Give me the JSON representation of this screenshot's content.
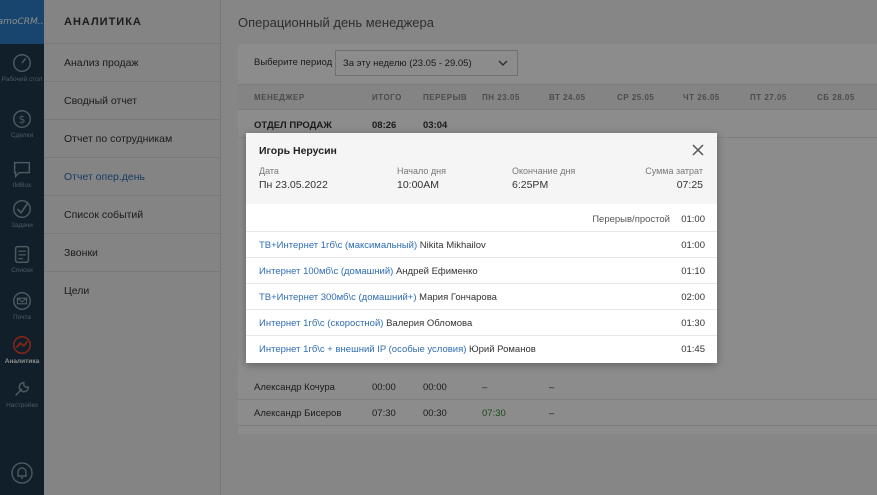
{
  "app": {
    "logo_text": "amoCRM..."
  },
  "rail": {
    "items": [
      {
        "label": "Рабочий стол",
        "icon": "dashboard-icon"
      },
      {
        "label": "Сделки",
        "icon": "dollar-icon"
      },
      {
        "label": "IMBox",
        "icon": "chat-icon"
      },
      {
        "label": "Задачи",
        "icon": "check-icon"
      },
      {
        "label": "Списки",
        "icon": "list-icon"
      },
      {
        "label": "Почта",
        "icon": "mail-icon"
      },
      {
        "label": "Аналитика",
        "icon": "analytics-icon",
        "active": true
      },
      {
        "label": "Настройки",
        "icon": "settings-icon"
      }
    ]
  },
  "submenu": {
    "title": "АНАЛИТИКА",
    "items": [
      {
        "label": "Анализ продаж"
      },
      {
        "label": "Сводный отчет"
      },
      {
        "label": "Отчет по сотрудникам"
      },
      {
        "label": "Отчет опер.день",
        "active": true
      },
      {
        "label": "Список событий"
      },
      {
        "label": "Звонки"
      },
      {
        "label": "Цели"
      }
    ]
  },
  "main": {
    "title": "Операционный день менеджера",
    "period_label": "Выберите период",
    "period_value": "За эту неделю (23.05 - 29.05)",
    "columns": [
      "МЕНЕДЖЕР",
      "ИТОГО",
      "ПЕРЕРЫВ",
      "ПН 23.05",
      "ВТ 24.05",
      "СР 25.05",
      "ЧТ 26.05",
      "ПТ 27.05",
      "СБ 28.05"
    ],
    "rows": [
      {
        "name": "ОТДЕЛ ПРОДАЖ",
        "total": "08:26",
        "break": "03:04",
        "mon": "",
        "tue": ""
      },
      {
        "name": "Александр Кочура",
        "total": "00:00",
        "break": "00:00",
        "mon": "–",
        "tue": "–"
      },
      {
        "name": "Александр Бисеров",
        "total": "07:30",
        "break": "00:30",
        "mon": "07:30",
        "tue": "–"
      }
    ]
  },
  "modal": {
    "title": "Игорь Нерусин",
    "date_label": "Дата",
    "date_value": "Пн 23.05.2022",
    "start_label": "Начало дня",
    "start_value": "10:00AM",
    "end_label": "Окончание дня",
    "end_value": "6:25PM",
    "sum_label": "Сумма затрат",
    "sum_value": "07:25",
    "break_label": "Перерыв/простой",
    "break_value": "01:00",
    "entries": [
      {
        "deal": "ТВ+Интернет 1гб\\с (максимальный)",
        "client": "Nikita Mikhailov",
        "duration": "01:00"
      },
      {
        "deal": "Интернет 100мб\\с (домашний)",
        "client": "Андрей Ефименко",
        "duration": "01:10"
      },
      {
        "deal": "ТВ+Интернет 300мб\\с (домашний+)",
        "client": "Мария Гончарова",
        "duration": "02:00"
      },
      {
        "deal": "Интернет 1гб\\с (скоростной)",
        "client": "Валерия Обломова",
        "duration": "01:30"
      },
      {
        "deal": "Интернет 1гб\\с + внешний IP (особые условия)",
        "client": "Юрий Романов",
        "duration": "01:45"
      }
    ]
  },
  "colors": {
    "rail_bg": "#1e3a4c",
    "logo_bg": "#2b7fc6",
    "link": "#2f6db5",
    "accent_active": "#e8452c",
    "green_value": "#2e8b2e"
  }
}
